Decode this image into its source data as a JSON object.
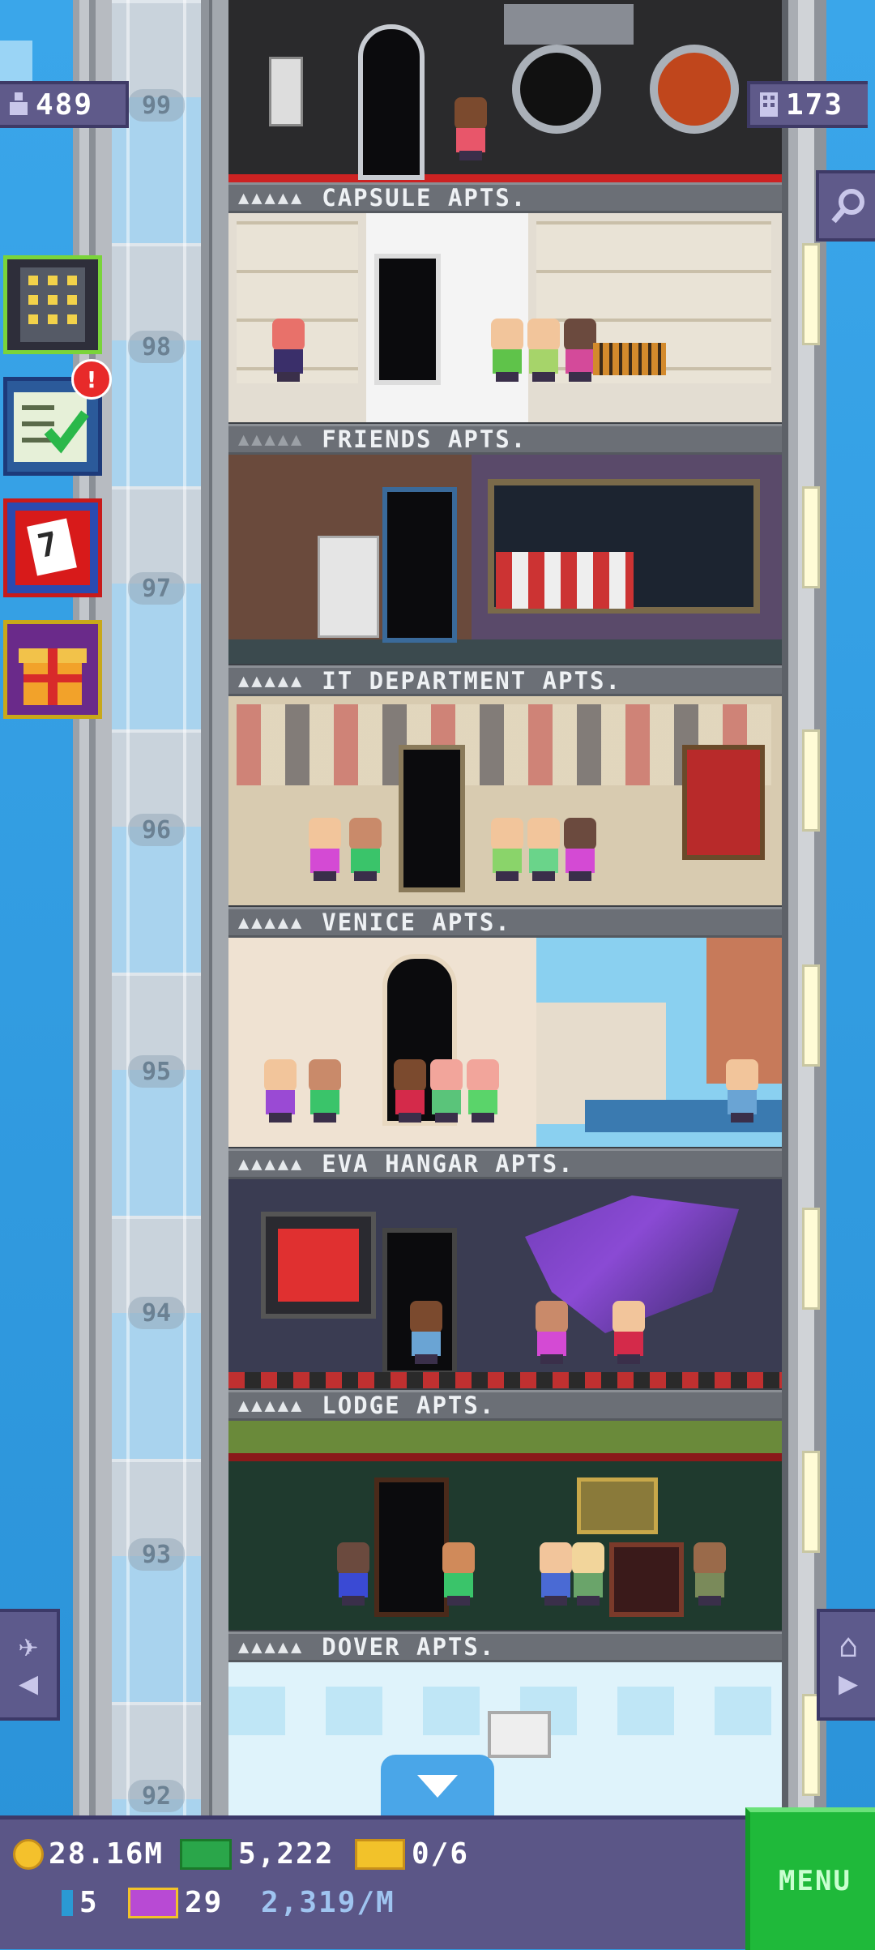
{
  "hud": {
    "population": "489",
    "floors": "173"
  },
  "floors": [
    {
      "number": "99",
      "name": "",
      "type": "capsule-top"
    },
    {
      "number": "98",
      "name": "CAPSULE APTS."
    },
    {
      "number": "97",
      "name": "FRIENDS APTS."
    },
    {
      "number": "96",
      "name": "IT DEPARTMENT APTS."
    },
    {
      "number": "95",
      "name": "VENICE APTS."
    },
    {
      "number": "94",
      "name": "EVA HANGAR APTS."
    },
    {
      "number": "93",
      "name": "LODGE APTS."
    },
    {
      "number": "92",
      "name": "DOVER APTS."
    }
  ],
  "stars": "▲▲▲▲▲",
  "notifications": {
    "missions_badge": "!"
  },
  "calendar_day": "7",
  "bottom": {
    "coins": "28.16M",
    "bux": "5,222",
    "tickets": "0/6",
    "keys": "5",
    "vip": "29",
    "rate": "2,319/M"
  },
  "menu_label": "MENU",
  "colors": {
    "sky": "#2e9be0",
    "hud": "#5f5a8a",
    "menu": "#1fb93a",
    "coin": "#f4c12c",
    "bux": "#2aa64a"
  },
  "icons": {
    "population": "person-icon",
    "floors": "building-icon",
    "search": "magnifier-icon",
    "build": "building-grid-icon",
    "missions": "checklist-icon",
    "calendar": "calendar-icon",
    "gift": "gift-icon",
    "elevator_down": "down-arrow-icon"
  }
}
